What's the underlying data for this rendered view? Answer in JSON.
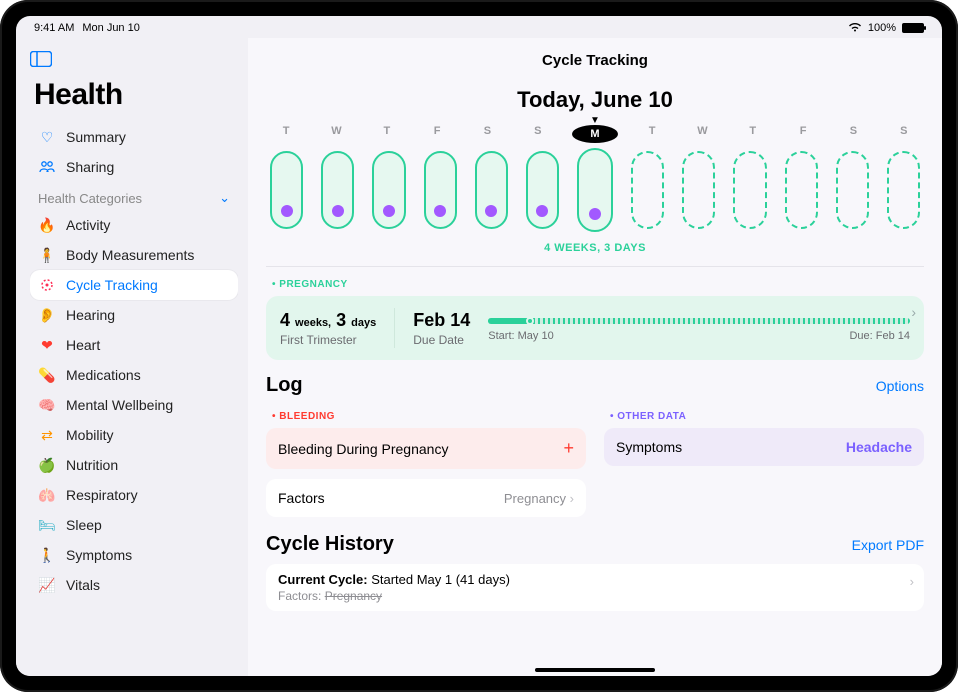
{
  "status": {
    "time": "9:41 AM",
    "date": "Mon Jun 10",
    "battery": "100%"
  },
  "app_title": "Health",
  "sidebar": {
    "summary": "Summary",
    "sharing": "Sharing",
    "section": "Health Categories",
    "items": [
      {
        "label": "Activity"
      },
      {
        "label": "Body Measurements"
      },
      {
        "label": "Cycle Tracking"
      },
      {
        "label": "Hearing"
      },
      {
        "label": "Heart"
      },
      {
        "label": "Medications"
      },
      {
        "label": "Mental Wellbeing"
      },
      {
        "label": "Mobility"
      },
      {
        "label": "Nutrition"
      },
      {
        "label": "Respiratory"
      },
      {
        "label": "Sleep"
      },
      {
        "label": "Symptoms"
      },
      {
        "label": "Vitals"
      }
    ]
  },
  "page": {
    "section_title": "Cycle Tracking",
    "today_title": "Today, June 10",
    "days": [
      "T",
      "W",
      "T",
      "F",
      "S",
      "S",
      "M",
      "T",
      "W",
      "T",
      "F",
      "S",
      "S"
    ],
    "duration": "4 WEEKS, 3 DAYS"
  },
  "pregnancy": {
    "label": "PREGNANCY",
    "weeks_num": "4",
    "weeks_unit": "weeks,",
    "days_num": "3",
    "days_unit": "days",
    "stage": "First Trimester",
    "due_value": "Feb 14",
    "due_label": "Due Date",
    "start_label": "Start: May 10",
    "due_right": "Due: Feb 14"
  },
  "log": {
    "title": "Log",
    "options": "Options",
    "bleeding_label": "BLEEDING",
    "bleeding_item": "Bleeding During Pregnancy",
    "factors_title": "Factors",
    "factors_value": "Pregnancy",
    "other_label": "OTHER DATA",
    "symptoms_title": "Symptoms",
    "symptoms_value": "Headache"
  },
  "history": {
    "title": "Cycle History",
    "export": "Export PDF",
    "current_bold": "Current Cycle:",
    "current_rest": " Started May 1 (41 days)",
    "factors_lbl": "Factors: ",
    "factors_val": "Pregnancy"
  }
}
